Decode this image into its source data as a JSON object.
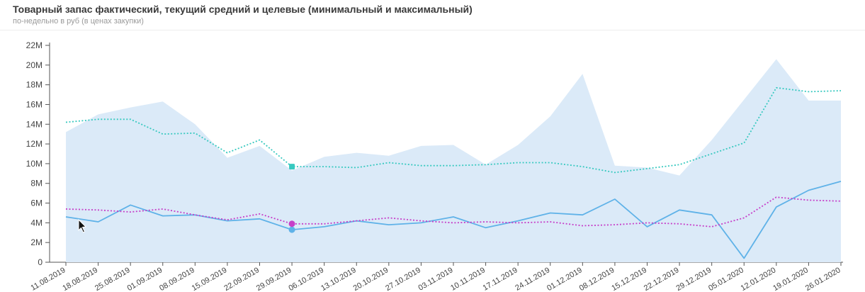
{
  "header": {
    "title": "Товарный запас фактический, текущий средний и целевые (минимальный и максимальный)",
    "subtitle": "по-недельно в руб (в ценах закупки)"
  },
  "chart_data": {
    "type": "line",
    "title": "Товарный запас фактический, текущий средний и целевые (минимальный и максимальный)",
    "subtitle": "по-недельно в руб (в ценах закупки)",
    "xlabel": "",
    "ylabel": "",
    "ylim": [
      0,
      22
    ],
    "y_unit": "M",
    "y_ticks": [
      0,
      2,
      4,
      6,
      8,
      10,
      12,
      14,
      16,
      18,
      20,
      22
    ],
    "y_tick_labels": [
      "0",
      "2M",
      "4M",
      "6M",
      "8M",
      "10M",
      "12M",
      "14M",
      "16M",
      "18M",
      "20M",
      "22M"
    ],
    "grid": false,
    "legend": "none",
    "categories": [
      "11.08.2019",
      "18.08.2019",
      "25.08.2019",
      "01.09.2019",
      "08.09.2019",
      "15.09.2019",
      "22.09.2019",
      "29.09.2019",
      "06.10.2019",
      "13.10.2019",
      "20.10.2019",
      "27.10.2019",
      "03.11.2019",
      "10.11.2019",
      "17.11.2019",
      "24.11.2019",
      "01.12.2019",
      "08.12.2019",
      "15.12.2019",
      "22.12.2019",
      "29.12.2019",
      "05.01.2020",
      "12.01.2020",
      "19.01.2020",
      "26.01.2020"
    ],
    "series": [
      {
        "kind": "area",
        "color": "#dbeaf8",
        "values": [
          13.2,
          15.0,
          15.7,
          16.3,
          14.0,
          10.6,
          11.8,
          9.3,
          10.7,
          11.1,
          10.8,
          11.8,
          11.9,
          9.9,
          11.9,
          14.8,
          19.1,
          9.8,
          9.6,
          8.8,
          12.4,
          16.5,
          20.6,
          16.4,
          16.4
        ]
      },
      {
        "kind": "dotted",
        "color": "#38c9c0",
        "values": [
          14.2,
          14.5,
          14.5,
          13.0,
          13.1,
          11.1,
          12.4,
          9.7,
          9.7,
          9.6,
          10.1,
          9.8,
          9.8,
          9.9,
          10.1,
          10.1,
          9.7,
          9.1,
          9.5,
          9.9,
          11.0,
          12.1,
          17.7,
          17.3,
          17.4
        ]
      },
      {
        "kind": "solid",
        "color": "#5fb2e8",
        "values": [
          4.6,
          4.1,
          5.8,
          4.7,
          4.8,
          4.2,
          4.4,
          3.3,
          3.6,
          4.2,
          3.8,
          4.0,
          4.6,
          3.5,
          4.2,
          5.0,
          4.8,
          6.4,
          3.6,
          5.3,
          4.8,
          0.4,
          5.6,
          7.3,
          8.2
        ]
      },
      {
        "kind": "dotted",
        "color": "#c63fc9",
        "values": [
          5.4,
          5.3,
          5.1,
          5.4,
          4.8,
          4.3,
          4.9,
          3.9,
          3.9,
          4.2,
          4.5,
          4.2,
          4.0,
          4.1,
          4.0,
          4.1,
          3.7,
          3.8,
          4.0,
          3.9,
          3.6,
          4.5,
          6.6,
          6.3,
          6.2
        ]
      }
    ],
    "markers": [
      {
        "series_index": 1,
        "category_index": 7,
        "value": 9.7,
        "color": "#38c9c0",
        "shape": "square"
      },
      {
        "series_index": 2,
        "category_index": 7,
        "value": 3.3,
        "color": "#5fb2e8",
        "shape": "circle"
      },
      {
        "series_index": 3,
        "category_index": 7,
        "value": 3.9,
        "color": "#c63fc9",
        "shape": "circle"
      }
    ]
  }
}
